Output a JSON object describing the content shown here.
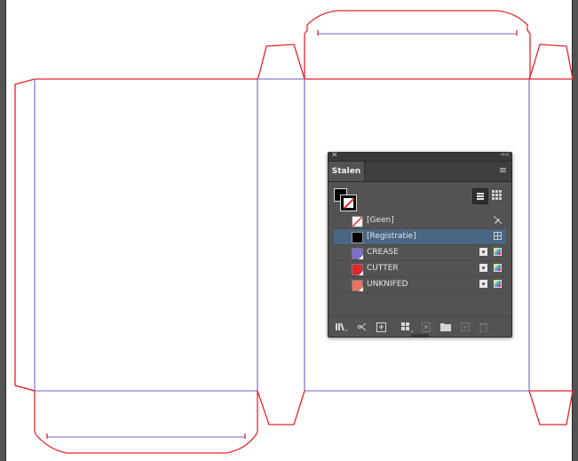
{
  "panel": {
    "tab_label": "Stalen",
    "close_glyph": "✕",
    "collapse_glyph": "<<",
    "menu_glyph": "≡"
  },
  "swatches": [
    {
      "name": "[Geen]",
      "color": "none",
      "icons": [
        "no-edit-icon"
      ]
    },
    {
      "name": "[Registratie]",
      "color": "#000000",
      "selected": true,
      "icons": [
        "registration-icon"
      ]
    },
    {
      "name": "CREASE",
      "color": "#7a6fd0",
      "icons": [
        "spot-color-icon",
        "cmyk-icon"
      ]
    },
    {
      "name": "CUTTER",
      "color": "#e8232a",
      "icons": [
        "spot-color-icon",
        "cmyk-icon"
      ]
    },
    {
      "name": "UNKNIFED",
      "color": "#f0705a",
      "icons": [
        "spot-color-icon",
        "cmyk-icon"
      ]
    }
  ],
  "colors": {
    "cut_line": "#e8232a",
    "crease_line": "#6e62c4",
    "pasteboard": "#535353",
    "selection": "#4b6584"
  }
}
